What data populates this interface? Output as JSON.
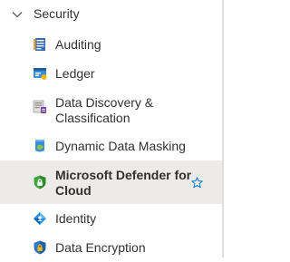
{
  "section": {
    "title": "Security"
  },
  "items": [
    {
      "label_line1": "Auditing",
      "label_line2": "",
      "icon": "auditing-icon"
    },
    {
      "label_line1": "Ledger",
      "label_line2": "",
      "icon": "ledger-icon"
    },
    {
      "label_line1": "Data Discovery &",
      "label_line2": "Classification",
      "icon": "data-discovery-icon"
    },
    {
      "label_line1": "Dynamic Data Masking",
      "label_line2": "",
      "icon": "data-masking-icon"
    },
    {
      "label_line1": "Microsoft Defender for",
      "label_line2": "Cloud",
      "icon": "defender-shield-icon",
      "selected": true
    },
    {
      "label_line1": "Identity",
      "label_line2": "",
      "icon": "identity-icon"
    },
    {
      "label_line1": "Data Encryption",
      "label_line2": "",
      "icon": "encryption-shield-icon"
    }
  ],
  "colors": {
    "selected_background": "#edebe9",
    "star": "#0078d4",
    "text": "#323130"
  }
}
